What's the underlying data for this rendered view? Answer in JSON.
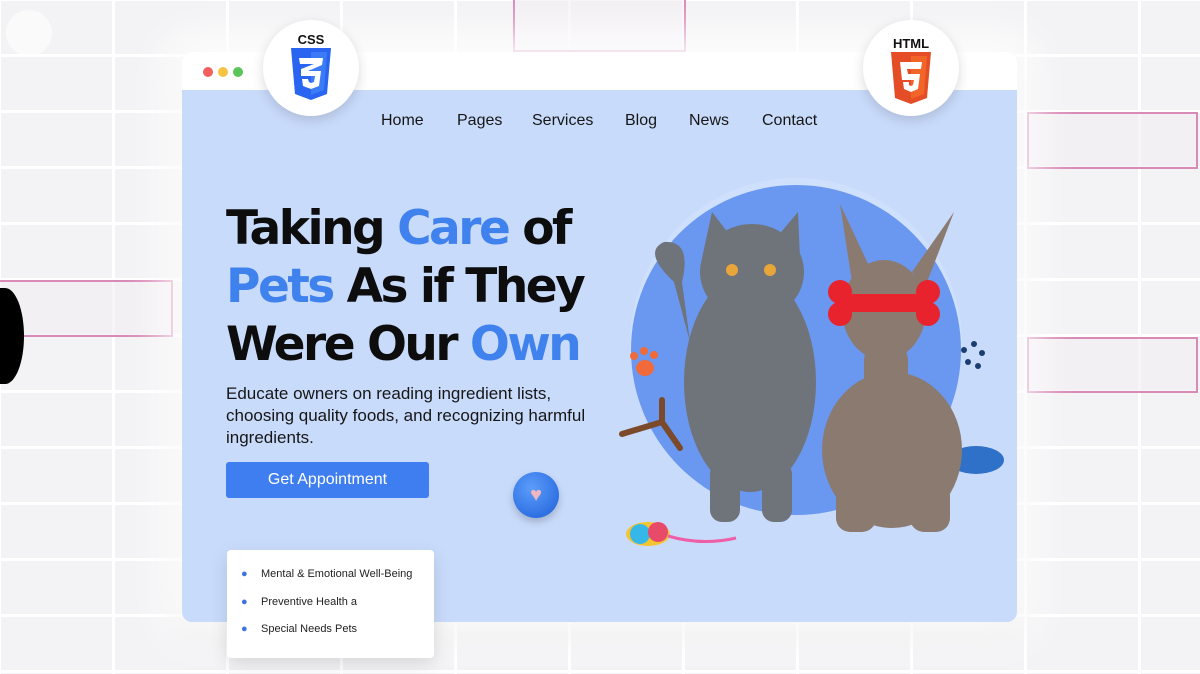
{
  "badges": {
    "css_label": "CSS",
    "css_icon": "css3-logo-icon",
    "html_label": "HTML",
    "html_icon": "html5-logo-icon",
    "css_color": "#2965f1",
    "html_color": "#e44d26"
  },
  "nav": {
    "items": [
      "Home",
      "Pages",
      "Services",
      "Blog",
      "News",
      "Contact"
    ]
  },
  "hero": {
    "title_parts": [
      "Taking ",
      "Care",
      " of ",
      "Pets",
      " As if They ",
      "Were Our ",
      "Own"
    ],
    "description": "Educate owners on reading ingredient lists, choosing quality foods, and recognizing harmful ingredients.",
    "cta_label": "Get Appointment",
    "heart_icon": "heart-icon"
  },
  "features": {
    "icon": "paw-icon",
    "items": [
      "Mental & Emotional Well-Being",
      "Preventive Health a",
      "Special Needs Pets"
    ]
  },
  "colors": {
    "accent": "#3f82ee",
    "page_bg": "#c9dbfb",
    "button": "#3f7ef0"
  }
}
